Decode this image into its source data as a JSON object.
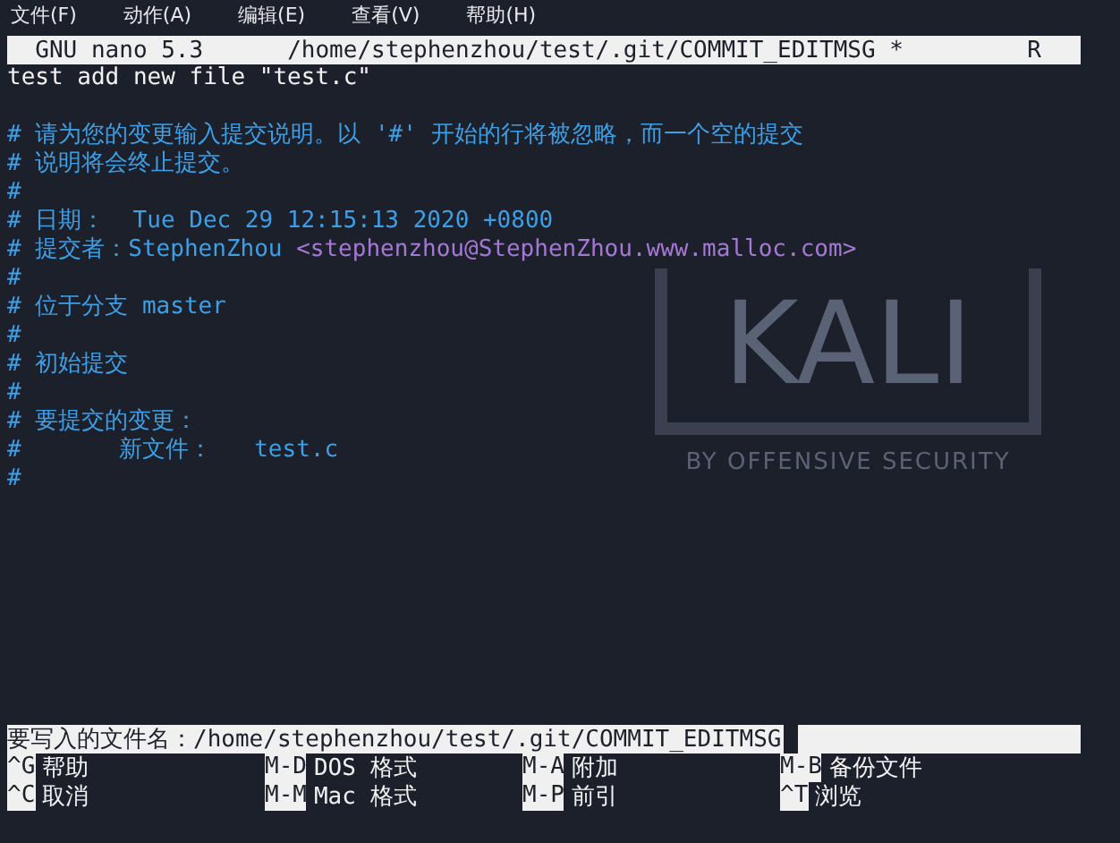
{
  "menu_bar": {
    "items": [
      "文件(F)",
      "动作(A)",
      "编辑(E)",
      "查看(V)",
      "帮助(H)"
    ]
  },
  "title_bar": {
    "app": "GNU nano 5.3",
    "path": "/home/stephenzhou/test/.git/COMMIT_EDITMSG *",
    "flag": "R"
  },
  "wallpaper": {
    "logo_text": "KALI",
    "tagline": "BY OFFENSIVE SECURITY"
  },
  "buffer": [
    {
      "parts": [
        {
          "kind": "plain",
          "text": "test add new file \"test.c\""
        }
      ]
    },
    {
      "kind": "blank"
    },
    {
      "parts": [
        {
          "kind": "comment",
          "text": "# 请为您的变更输入提交说明。以 '#' 开始的行将被忽略，而一个空的提交"
        }
      ]
    },
    {
      "parts": [
        {
          "kind": "comment",
          "text": "# 说明将会终止提交。"
        }
      ]
    },
    {
      "parts": [
        {
          "kind": "comment",
          "text": "#"
        }
      ]
    },
    {
      "parts": [
        {
          "kind": "comment",
          "text": "# 日期：  Tue Dec 29 12:15:13 2020 +0800"
        }
      ]
    },
    {
      "parts": [
        {
          "kind": "comment",
          "text": "# 提交者：StephenZhou "
        },
        {
          "kind": "email",
          "text": "<stephenzhou@StephenZhou.www.malloc.com>"
        }
      ]
    },
    {
      "parts": [
        {
          "kind": "comment",
          "text": "#"
        }
      ]
    },
    {
      "parts": [
        {
          "kind": "comment",
          "text": "# 位于分支 master"
        }
      ]
    },
    {
      "parts": [
        {
          "kind": "comment",
          "text": "#"
        }
      ]
    },
    {
      "parts": [
        {
          "kind": "comment",
          "text": "# 初始提交"
        }
      ]
    },
    {
      "parts": [
        {
          "kind": "comment",
          "text": "#"
        }
      ]
    },
    {
      "parts": [
        {
          "kind": "comment",
          "text": "# 要提交的变更："
        }
      ]
    },
    {
      "parts": [
        {
          "kind": "comment",
          "text": "#       新文件：   test.c"
        }
      ]
    },
    {
      "parts": [
        {
          "kind": "comment",
          "text": "#"
        }
      ]
    }
  ],
  "prompt": {
    "label": "要写入的文件名：",
    "value": "/home/stephenzhou/test/.git/COMMIT_EDITMSG"
  },
  "shortcuts": [
    {
      "key": "^G",
      "label": "帮助"
    },
    {
      "key": "M-D",
      "label": "DOS 格式"
    },
    {
      "key": "M-A",
      "label": "附加"
    },
    {
      "key": "M-B",
      "label": "备份文件"
    },
    {
      "key": "^C",
      "label": "取消"
    },
    {
      "key": "M-M",
      "label": "Mac 格式"
    },
    {
      "key": "M-P",
      "label": "前引"
    },
    {
      "key": "^T",
      "label": "浏览"
    }
  ]
}
